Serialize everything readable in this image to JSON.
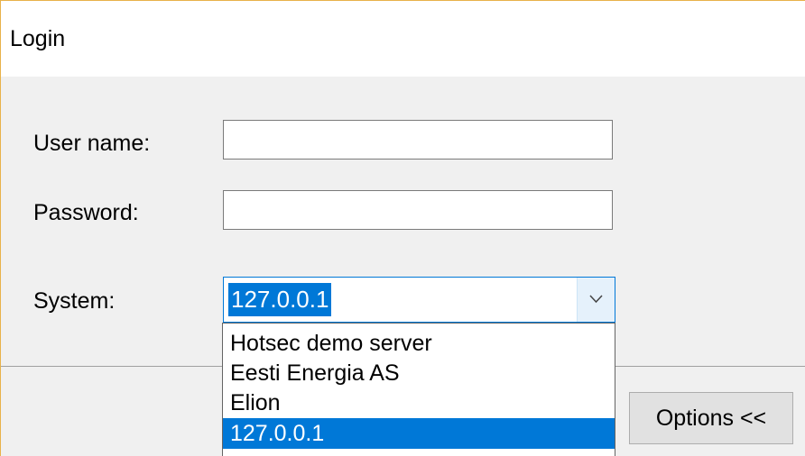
{
  "window": {
    "title": "Login"
  },
  "form": {
    "username_label": "User name:",
    "username_value": "",
    "password_label": "Password:",
    "password_value": "",
    "system_label": "System:",
    "system_selected": "127.0.0.1",
    "system_options": [
      "Hotsec demo server",
      "Eesti Energia AS",
      "Elion",
      "127.0.0.1"
    ]
  },
  "footer": {
    "options_label": "Options <<"
  },
  "icons": {
    "combo_arrow": "chevron-down-icon"
  },
  "colors": {
    "accent": "#0078d7",
    "panel_background": "#f0f0f0",
    "window_border": "#e8b24a"
  }
}
